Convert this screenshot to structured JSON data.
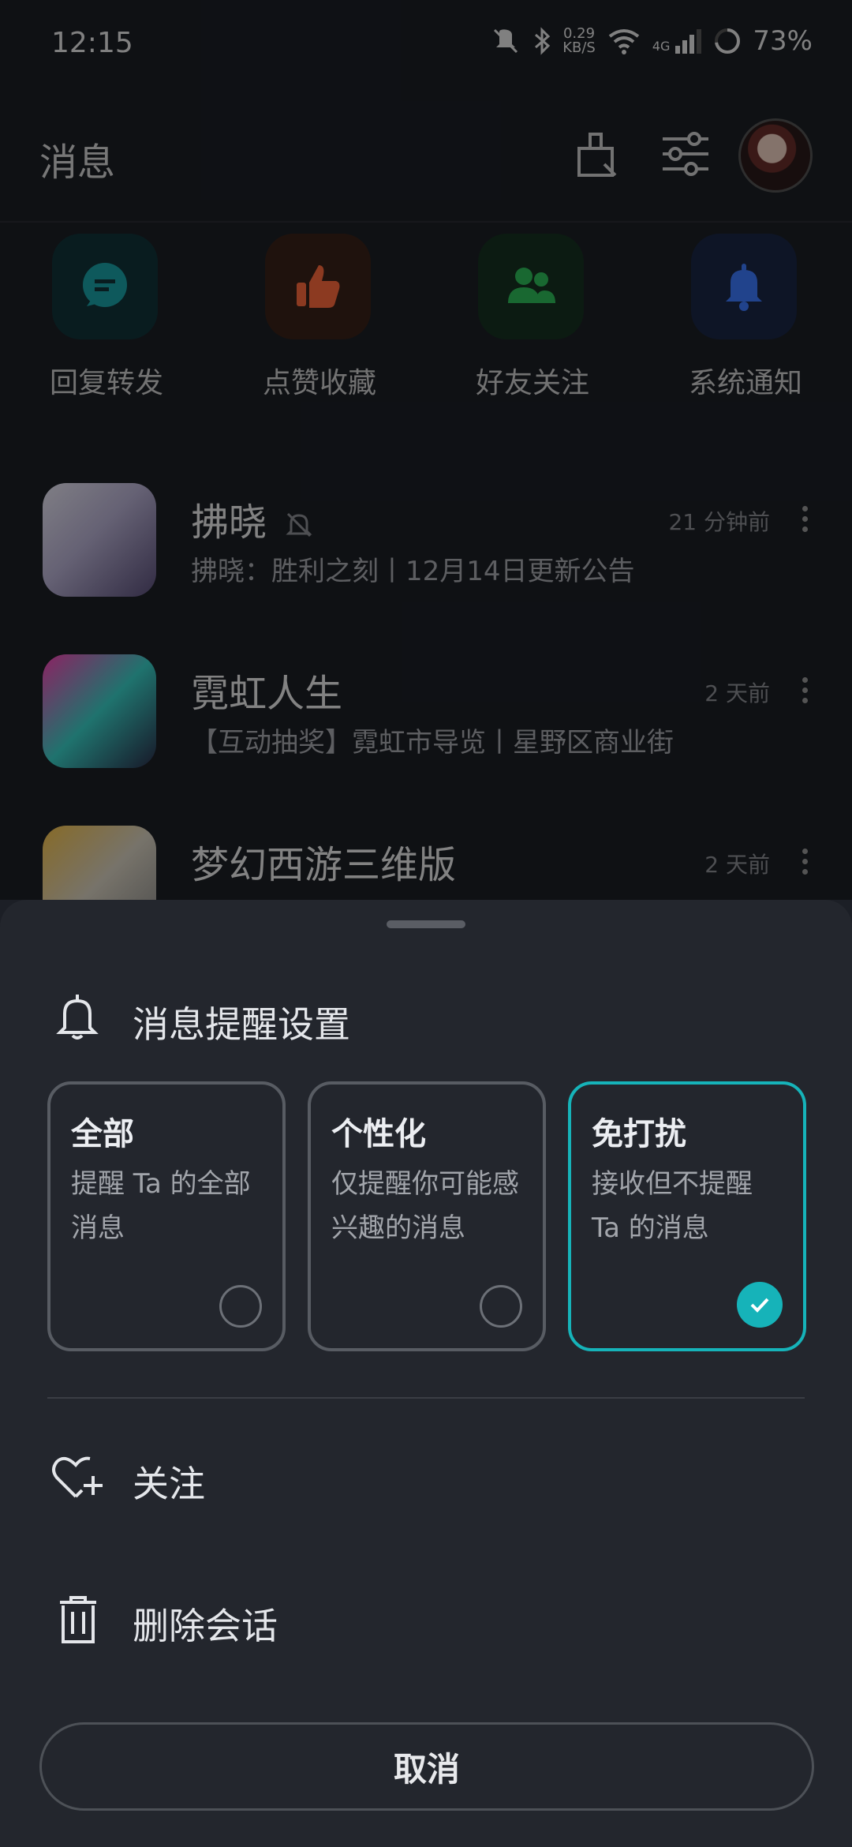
{
  "status_bar": {
    "time": "12:15",
    "net_speed_value": "0.29",
    "net_speed_unit": "KB/S",
    "signal_label": "4G",
    "battery": "73%"
  },
  "header": {
    "title": "消息"
  },
  "quick_actions": [
    {
      "label": "回复转发",
      "icon": "chat-bubble-icon",
      "color": "#1aa3a8"
    },
    {
      "label": "点赞收藏",
      "icon": "thumb-up-icon",
      "color": "#ff6a3d"
    },
    {
      "label": "好友关注",
      "icon": "people-icon",
      "color": "#2fbe5a"
    },
    {
      "label": "系统通知",
      "icon": "bell-icon",
      "color": "#3d7bff"
    }
  ],
  "conversations": [
    {
      "name": "拂晓",
      "muted_icon": "bell-off-icon",
      "time": "21 分钟前",
      "preview": "拂晓：胜利之刻丨12月14日更新公告"
    },
    {
      "name": "霓虹人生",
      "time": "2 天前",
      "preview": "【互动抽奖】霓虹市导览丨星野区商业街"
    },
    {
      "name": "梦幻西游三维版",
      "time": "2 天前",
      "preview": ""
    }
  ],
  "sheet": {
    "title": "消息提醒设置",
    "options": [
      {
        "title": "全部",
        "desc": "提醒 Ta 的全部消息",
        "selected": false
      },
      {
        "title": "个性化",
        "desc": "仅提醒你可能感兴趣的消息",
        "selected": false
      },
      {
        "title": "免打扰",
        "desc": "接收但不提醒 Ta 的消息",
        "selected": true
      }
    ],
    "follow_label": "关注",
    "delete_label": "删除会话",
    "cancel_label": "取消"
  },
  "colors": {
    "accent": "#16b3b9",
    "sheet_bg": "#23262d",
    "page_bg": "#1c1f26"
  }
}
